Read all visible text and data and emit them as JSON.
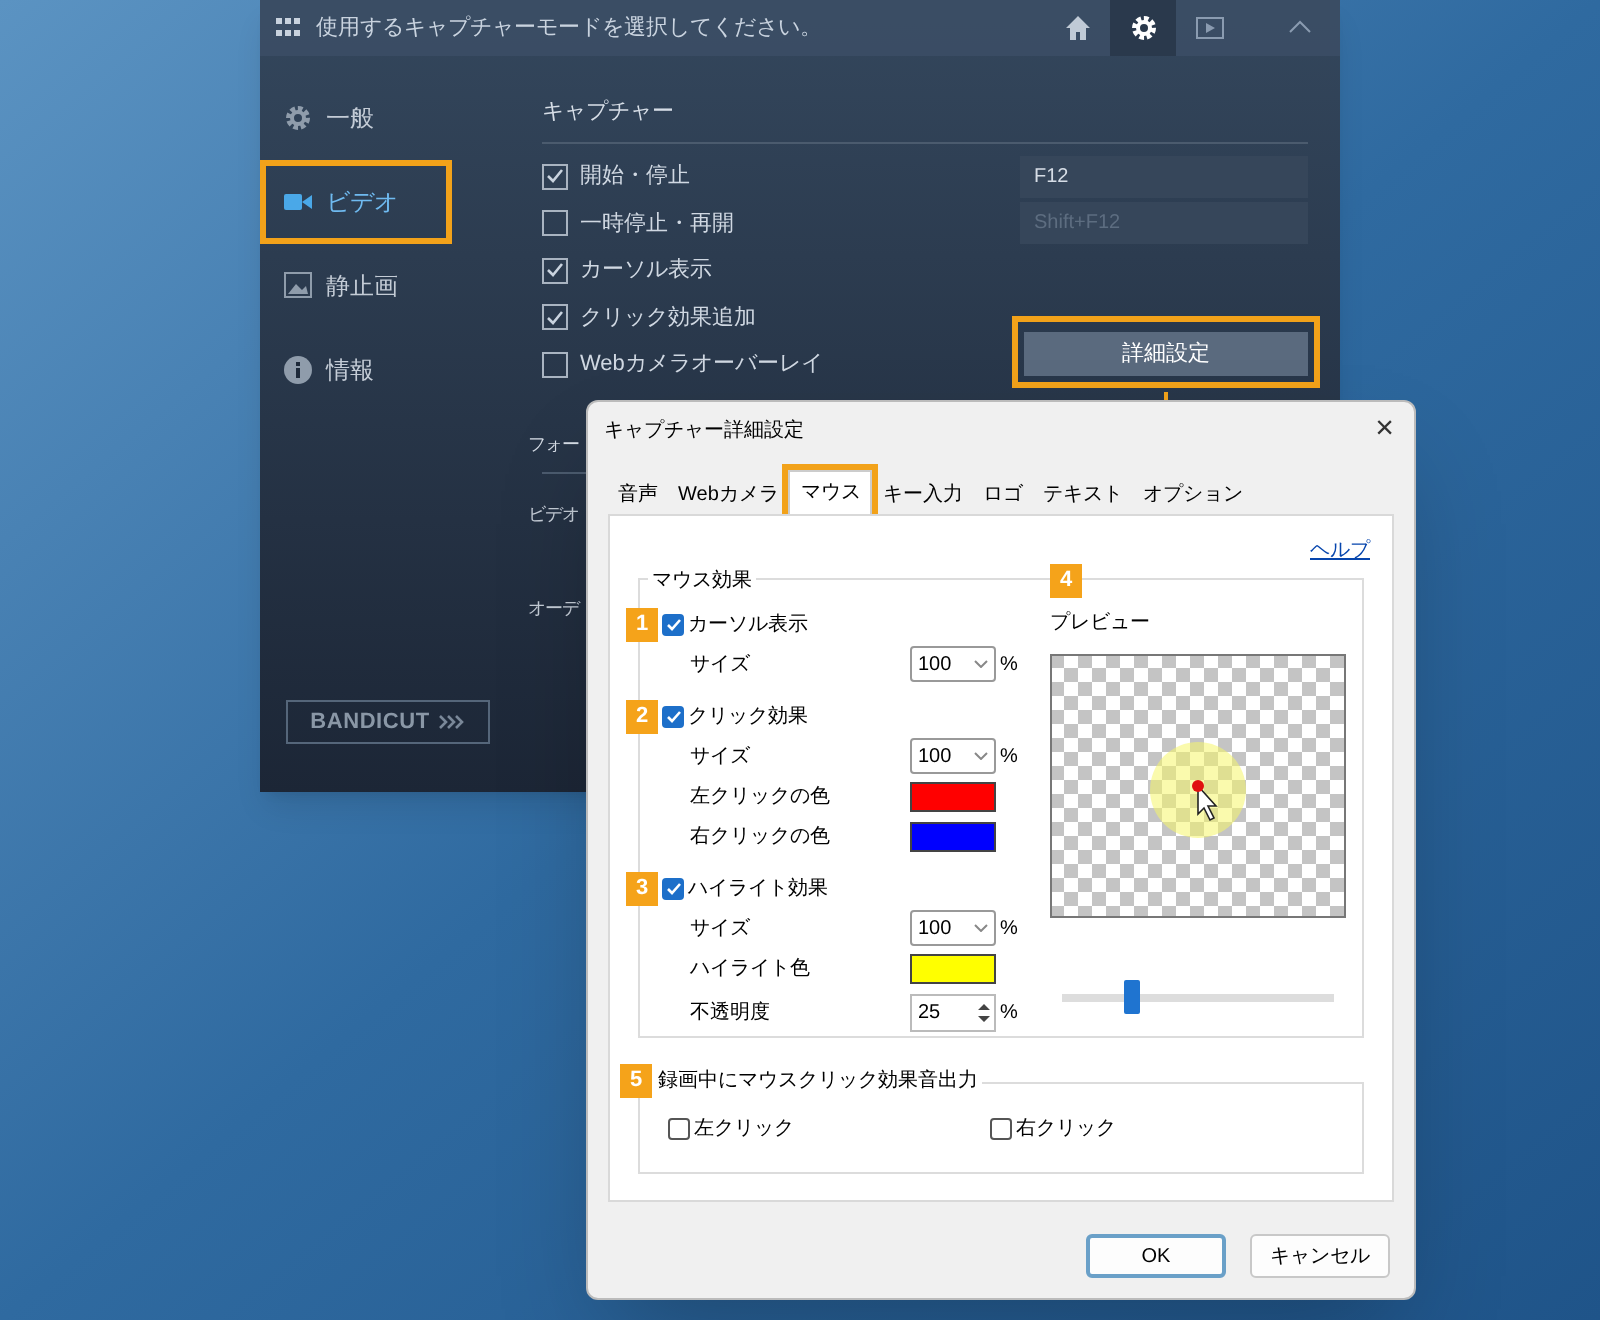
{
  "main_window": {
    "title": "使用するキャプチャーモードを選択してください。",
    "toolbar": [
      {
        "kind": "home",
        "selected": false
      },
      {
        "kind": "settings",
        "selected": true
      },
      {
        "kind": "video",
        "selected": false
      },
      {
        "kind": "collapse",
        "selected": false
      }
    ],
    "sidebar": {
      "items": [
        {
          "kind": "general",
          "label": "一般",
          "selected": false,
          "annotated": false
        },
        {
          "kind": "video",
          "label": "ビデオ",
          "selected": true,
          "annotated": true
        },
        {
          "kind": "image",
          "label": "静止画",
          "selected": false,
          "annotated": false
        },
        {
          "kind": "info",
          "label": "情報",
          "selected": false,
          "annotated": false
        }
      ],
      "bandicut": "BANDICUT"
    },
    "capture": {
      "title": "キャプチャー",
      "options": [
        {
          "label": "開始・停止",
          "checked": true,
          "hotkey": {
            "value": "F12",
            "disabled": false
          }
        },
        {
          "label": "一時停止・再開",
          "checked": false,
          "hotkey": {
            "value": "Shift+F12",
            "disabled": true
          }
        },
        {
          "label": "カーソル表示",
          "checked": true
        },
        {
          "label": "クリック効果追加",
          "checked": true
        },
        {
          "label": "Webカメラオーバーレイ",
          "checked": false,
          "action": {
            "label": "詳細設定",
            "annotated": true
          }
        }
      ]
    },
    "format": {
      "title": "フォー",
      "rows": [
        "ビデオ",
        "オーデ"
      ]
    }
  },
  "dialog": {
    "title": "キャプチャー詳細設定",
    "close": "×",
    "tabs": [
      {
        "label": "音声",
        "selected": false,
        "annotated": false
      },
      {
        "label": "Webカメラ",
        "selected": false,
        "annotated": false
      },
      {
        "label": "マウス",
        "selected": true,
        "annotated": true
      },
      {
        "label": "キー入力",
        "selected": false,
        "annotated": false
      },
      {
        "label": "ロゴ",
        "selected": false,
        "annotated": false
      },
      {
        "label": "テキスト",
        "selected": false,
        "annotated": false
      },
      {
        "label": "オプション",
        "selected": false,
        "annotated": false
      }
    ],
    "help_link": "ヘルプ",
    "mouse_effects": {
      "title": "マウス効果",
      "sections": [
        {
          "badge": "1",
          "label": "カーソル表示",
          "checked": true,
          "rows": [
            {
              "kind": "select",
              "label": "サイズ",
              "value": "100",
              "unit": "%"
            }
          ]
        },
        {
          "badge": "2",
          "label": "クリック効果",
          "checked": true,
          "rows": [
            {
              "kind": "select",
              "label": "サイズ",
              "value": "100",
              "unit": "%"
            },
            {
              "kind": "color",
              "label": "左クリックの色",
              "color": "#ff0000"
            },
            {
              "kind": "color",
              "label": "右クリックの色",
              "color": "#0000ff"
            }
          ]
        },
        {
          "badge": "3",
          "label": "ハイライト効果",
          "checked": true,
          "rows": [
            {
              "kind": "select",
              "label": "サイズ",
              "value": "100",
              "unit": "%"
            },
            {
              "kind": "color",
              "label": "ハイライト色",
              "color": "#ffff00"
            },
            {
              "kind": "spin",
              "label": "不透明度",
              "value": "25",
              "unit": "%"
            }
          ]
        }
      ],
      "preview": {
        "badge": "4",
        "label": "プレビュー",
        "level": 0.26
      }
    },
    "sound": {
      "badge": "5",
      "title": "録画中にマウスクリック効果音出力",
      "options": [
        {
          "label": "左クリック",
          "checked": false
        },
        {
          "label": "右クリック",
          "checked": false
        }
      ]
    },
    "buttons": [
      {
        "label": "OK",
        "default": true
      },
      {
        "label": "キャンセル",
        "default": false
      }
    ]
  }
}
